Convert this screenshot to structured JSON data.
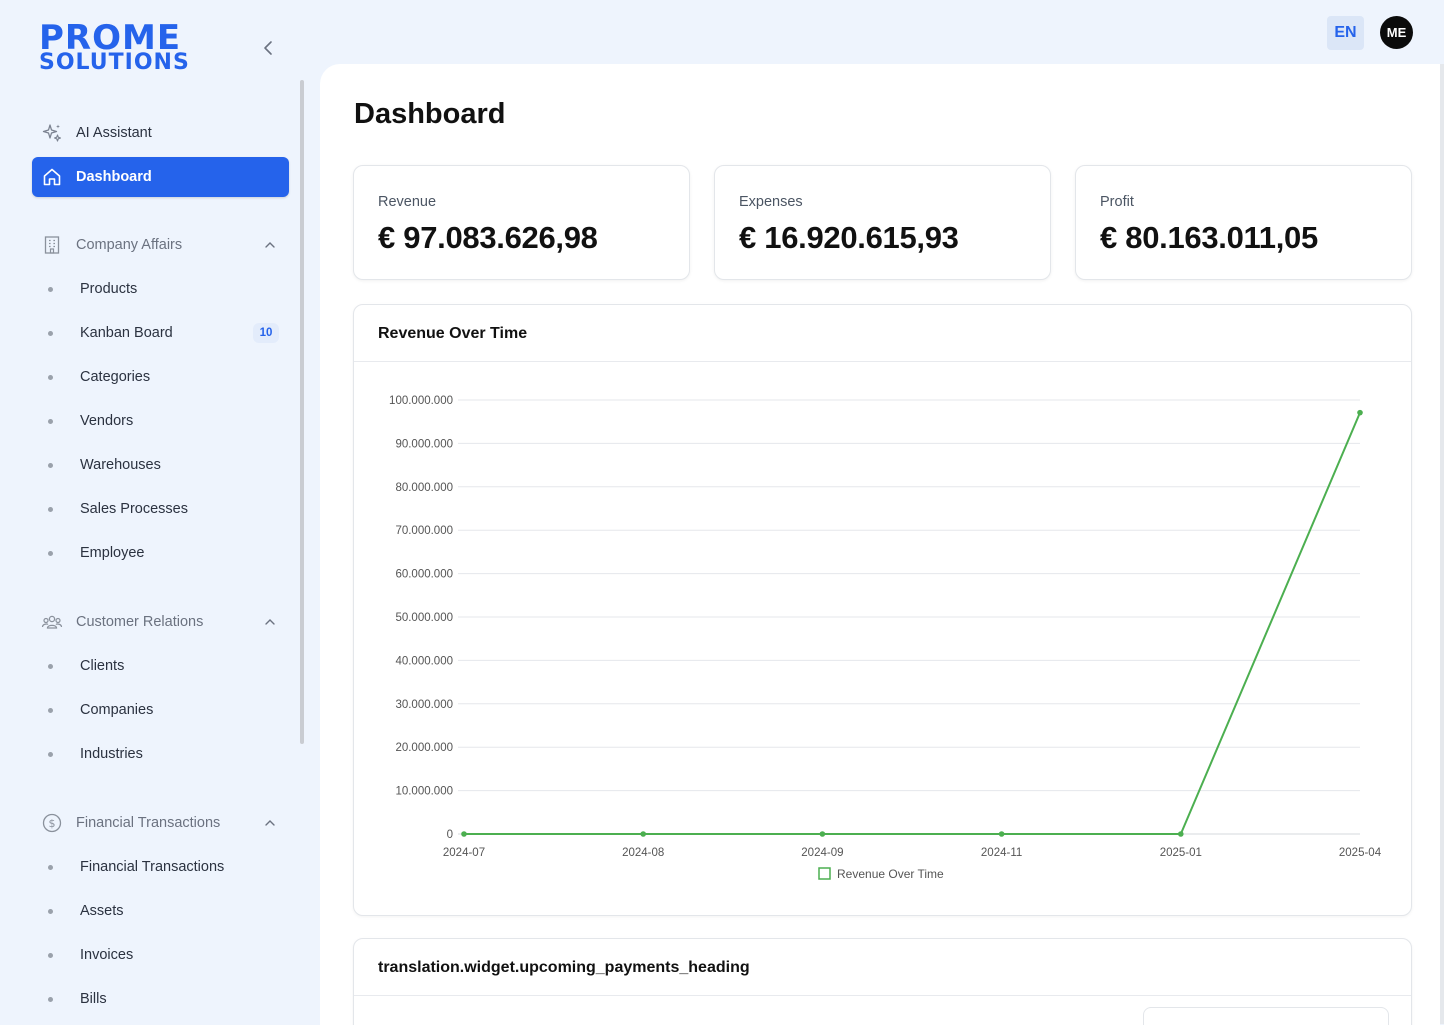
{
  "brand": {
    "line1": "PROME",
    "line2": "SOLUTIONS"
  },
  "sidebar": {
    "ai_assistant": "AI Assistant",
    "dashboard": "Dashboard",
    "sections": [
      {
        "label": "Company Affairs",
        "items": [
          {
            "label": "Products"
          },
          {
            "label": "Kanban Board",
            "badge": "10"
          },
          {
            "label": "Categories"
          },
          {
            "label": "Vendors"
          },
          {
            "label": "Warehouses"
          },
          {
            "label": "Sales Processes"
          },
          {
            "label": "Employee"
          }
        ]
      },
      {
        "label": "Customer Relations",
        "items": [
          {
            "label": "Clients"
          },
          {
            "label": "Companies"
          },
          {
            "label": "Industries"
          }
        ]
      },
      {
        "label": "Financial Transactions",
        "items": [
          {
            "label": "Financial Transactions"
          },
          {
            "label": "Assets"
          },
          {
            "label": "Invoices"
          },
          {
            "label": "Bills"
          }
        ]
      }
    ]
  },
  "topbar": {
    "language": "EN",
    "avatar_initials": "ME"
  },
  "page": {
    "title": "Dashboard"
  },
  "stats": [
    {
      "label": "Revenue",
      "value": "€ 97.083.626,98"
    },
    {
      "label": "Expenses",
      "value": "€ 16.920.615,93"
    },
    {
      "label": "Profit",
      "value": "€ 80.163.011,05"
    }
  ],
  "revenue_panel": {
    "title": "Revenue Over Time"
  },
  "payments_panel": {
    "title": "translation.widget.upcoming_payments_heading"
  },
  "colors": {
    "accent": "#2563eb",
    "series": "#4caf50"
  },
  "chart_data": {
    "type": "line",
    "title": "Revenue Over Time",
    "categories": [
      "2024-07",
      "2024-08",
      "2024-09",
      "2024-11",
      "2025-01",
      "2025-04"
    ],
    "series": [
      {
        "name": "Revenue Over Time",
        "values": [
          0,
          0,
          0,
          0,
          0,
          97083627
        ]
      }
    ],
    "ylim": [
      0,
      100000000
    ],
    "yticks": [
      0,
      10000000,
      20000000,
      30000000,
      40000000,
      50000000,
      60000000,
      70000000,
      80000000,
      90000000,
      100000000
    ],
    "ytick_labels": [
      "0",
      "10.000.000",
      "20.000.000",
      "30.000.000",
      "40.000.000",
      "50.000.000",
      "60.000.000",
      "70.000.000",
      "80.000.000",
      "90.000.000",
      "100.000.000"
    ],
    "grid": true,
    "legend": "bottom"
  }
}
